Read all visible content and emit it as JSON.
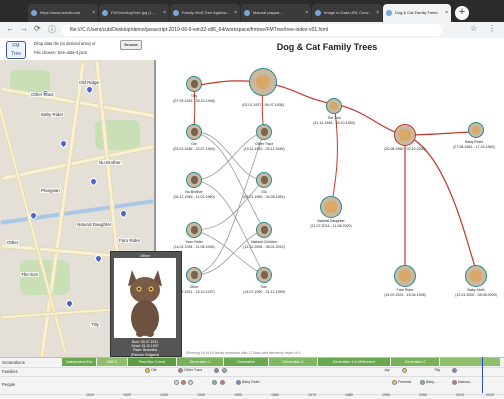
{
  "browser": {
    "tabs": [
      {
        "label": "https://www.reddit.com"
      },
      {
        "label": "FMTree/dogTree.jpg (1..."
      },
      {
        "label": "Family Wolf-Tree Applica..."
      },
      {
        "label": "Manual pappar..."
      },
      {
        "label": "Image to Data URL Conv..."
      },
      {
        "label": "Dog & Cat Family Trees"
      }
    ],
    "url": "file:///C:/Users/cub/Desktop/demo/javascript-2019-06-9-win32-x86_64/workspace/fmtree/FMTree/tree-index-v01.html"
  },
  "app": {
    "logo": "FM Tree",
    "drop_label": "Drop data file (to derived area) or",
    "browse_label": "Browse",
    "file_chosen": "File chosen: tree-data-4.json",
    "title": "Dog & Cat Family Trees"
  },
  "map": {
    "labels": [
      "Other Tract",
      "Old Ridge",
      "Baby Rider",
      "Nu Brother",
      "Ploegsan",
      "Natural Daughter",
      "The Son",
      "Tilly",
      "Faro Rider",
      "Other"
    ]
  },
  "tree": {
    "nodes": [
      {
        "id": "tilly",
        "name": "Tilly",
        "dates": "(07.09.1943 - 25.10.1946)",
        "kind": "cat"
      },
      {
        "id": "elder",
        "name": "",
        "dates": "(02.01.1927 - 06.07.1938)",
        "kind": "dog"
      },
      {
        "id": "theson",
        "name": "The Son",
        "dates": "(31.12.1946 - 24.10.1954)",
        "kind": "dog"
      },
      {
        "id": "centre",
        "name": "",
        "dates": "(20.08.1950 - 02.10.2000)",
        "kind": "dog"
      },
      {
        "id": "babyrider",
        "name": "Baby Rider",
        "dates": "(27.08.1962 - 17.02.1962)",
        "kind": "dog"
      },
      {
        "id": "ole",
        "name": "Ole",
        "dates": "(03.01.1936 - 22.07.1944)",
        "kind": "cat"
      },
      {
        "id": "othertract",
        "name": "Other Tract",
        "dates": "(19.11.1930 - 03.11.1945)",
        "kind": "cat"
      },
      {
        "id": "nubrother",
        "name": "Nu Brother",
        "dates": "(26.12.1946 - 11.01.1960)",
        "kind": "cat"
      },
      {
        "id": "olu",
        "name": "Olu",
        "dates": "(01.01.1950 - 24.05.1951)",
        "kind": "cat"
      },
      {
        "id": "natdaughter1",
        "name": "Natural Daughter",
        "dates": "(21.07.2014 - 11.08.2020)",
        "kind": "dog"
      },
      {
        "id": "youngrider",
        "name": "Youn Rider",
        "dates": "(14.02.1934 - 11.08.1936)",
        "kind": "cat"
      },
      {
        "id": "natchildren",
        "name": "Natural Children",
        "dates": "(13.12.2005 - 08.01.2012)",
        "kind": "cat"
      },
      {
        "id": "other",
        "name": "Other",
        "dates": "(05.07.1931 - 15.10.1937)",
        "kind": "cat"
      },
      {
        "id": "tom",
        "name": "Tom",
        "dates": "(14.07.1990 - 21.12.1999)",
        "kind": "cat"
      },
      {
        "id": "freerider",
        "name": "Free Rider",
        "dates": "(14.02.1924 - 15.04.1936)",
        "kind": "dog"
      },
      {
        "id": "babymoth",
        "name": "Baby Moth",
        "dates": "(12.01.2005 - 08.08.2009)",
        "kind": "dog"
      }
    ],
    "showing": "Showing 16 of 16 family members with 17 links and hierarchy depth of 5"
  },
  "card": {
    "title": "Other",
    "born": "Born: 05.07.1931",
    "dead": "Dead: 15.10.1937",
    "place": "Place: Bravelina",
    "country": "(Parents: Bulgaria)"
  },
  "timeline": {
    "rows": {
      "generations": "Generations",
      "families": "Families",
      "people": "People"
    },
    "generations": [
      {
        "label": "Independent Era",
        "color": "#6aa84f"
      },
      {
        "label": "WW II",
        "color": "#8fbf6c"
      },
      {
        "label": "Post-War Cohort",
        "color": "#5c9d44"
      },
      {
        "label": "Generation 1",
        "color": "#78b15a"
      },
      {
        "label": "Generation",
        "color": "#6aa84f"
      },
      {
        "label": "Generation 2",
        "color": "#7fb863"
      },
      {
        "label": "Generation 1 in Millennium",
        "color": "#6aa84f"
      },
      {
        "label": "Generation 2",
        "color": "#78b15a"
      },
      {
        "label": "",
        "color": "#8fbf6c"
      }
    ],
    "family_names": [
      "Ole",
      "Other Tract",
      "Baby Rider",
      "Jay",
      "Free Rider",
      "Tilly"
    ],
    "people_names": [
      "Baby Rider",
      "Freeride",
      "Baby ...",
      "Natural..."
    ],
    "ticks": [
      "1910",
      "1920",
      "1930",
      "1940",
      "1950",
      "1960",
      "1970",
      "1980",
      "1990",
      "2000",
      "2010",
      "2020"
    ]
  },
  "colors": {
    "teal": "#2a8a8a",
    "red": "#c0392b",
    "link_red": "#c0392b",
    "link_grey": "#9a9a9a",
    "gen_green": "#6aa84f"
  }
}
